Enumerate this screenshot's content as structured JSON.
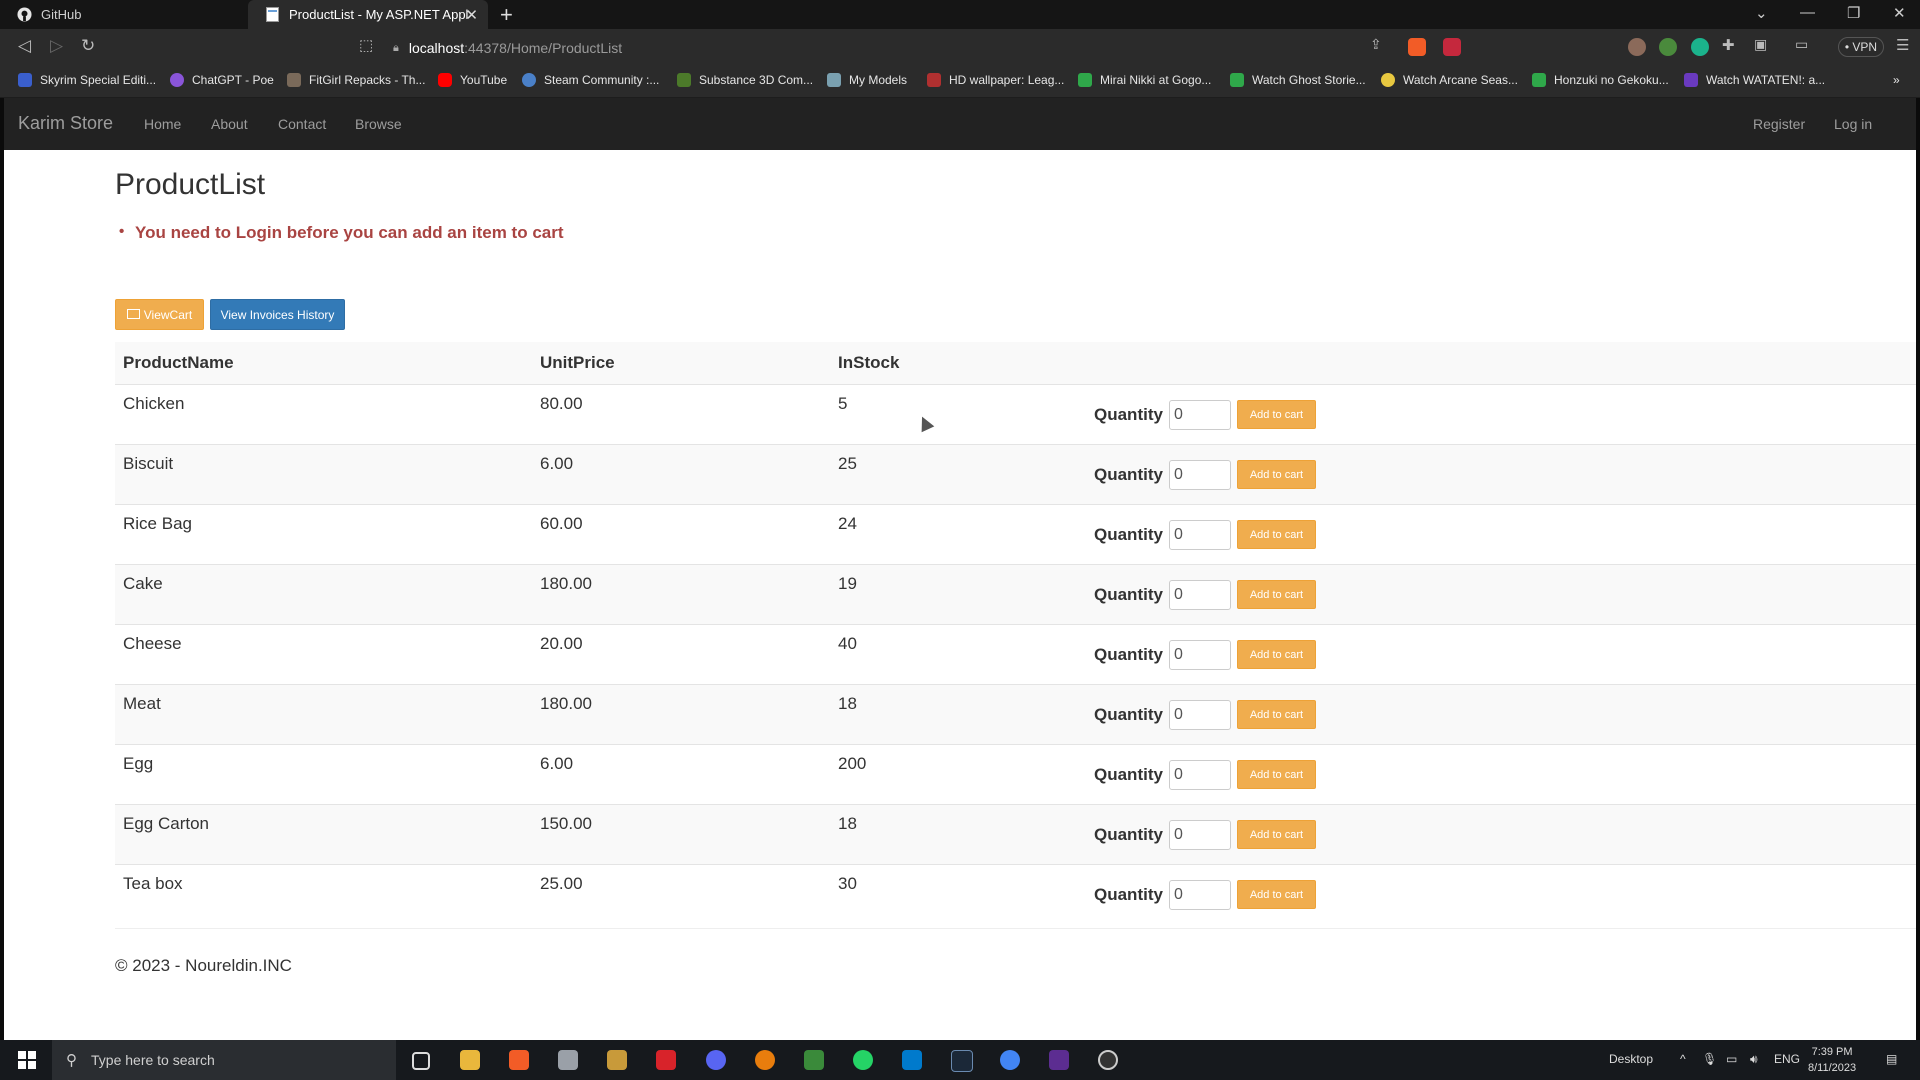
{
  "browser": {
    "tabs": [
      {
        "title": "GitHub",
        "icon": "github-icon",
        "active": false
      },
      {
        "title": "ProductList - My ASP.NET Applic",
        "icon": "page-icon",
        "active": true
      }
    ],
    "url_host": "localhost",
    "url_path": ":44378/Home/ProductList",
    "vpn_label": "• VPN",
    "bookmarks": [
      "Skyrim Special Editi...",
      "ChatGPT - Poe",
      "FitGirl Repacks - Th...",
      "YouTube",
      "Steam Community :...",
      "Substance 3D Com...",
      "My Models",
      "HD wallpaper: Leag...",
      "Mirai Nikki at Gogo...",
      "Watch Ghost Storie...",
      "Watch Arcane Seas...",
      "Honzuki no Gekoku...",
      "Watch WATATEN!: a..."
    ]
  },
  "site": {
    "brand": "Karim Store",
    "nav": [
      "Home",
      "About",
      "Contact",
      "Browse"
    ],
    "nav_right": [
      "Register",
      "Log in"
    ]
  },
  "page": {
    "title": "ProductList",
    "validation_message": "You need to Login before you can add an item to cart",
    "view_cart_label": "ViewCart",
    "view_invoices_label": "View Invoices History",
    "columns": [
      "ProductName",
      "UnitPrice",
      "InStock"
    ],
    "quantity_label": "Quantity",
    "add_label": "Add to cart",
    "products": [
      {
        "name": "Chicken",
        "price": "80.00",
        "stock": "5",
        "qty": "0"
      },
      {
        "name": "Biscuit",
        "price": "6.00",
        "stock": "25",
        "qty": "0"
      },
      {
        "name": "Rice Bag",
        "price": "60.00",
        "stock": "24",
        "qty": "0"
      },
      {
        "name": "Cake",
        "price": "180.00",
        "stock": "19",
        "qty": "0"
      },
      {
        "name": "Cheese",
        "price": "20.00",
        "stock": "40",
        "qty": "0"
      },
      {
        "name": "Meat",
        "price": "180.00",
        "stock": "18",
        "qty": "0"
      },
      {
        "name": "Egg",
        "price": "6.00",
        "stock": "200",
        "qty": "0"
      },
      {
        "name": "Egg Carton",
        "price": "150.00",
        "stock": "18",
        "qty": "0"
      },
      {
        "name": "Tea box",
        "price": "25.00",
        "stock": "30",
        "qty": "0"
      }
    ],
    "footer": "© 2023 - Noureldin.INC"
  },
  "taskbar": {
    "search_placeholder": "Type here to search",
    "desktop_label": "Desktop",
    "lang": "ENG",
    "time": "7:39 PM",
    "date": "8/11/2023"
  },
  "colors": {
    "warning": "#f0ad4e",
    "primary": "#337ab7",
    "danger_text": "#a94442",
    "site_nav": "#222222"
  }
}
